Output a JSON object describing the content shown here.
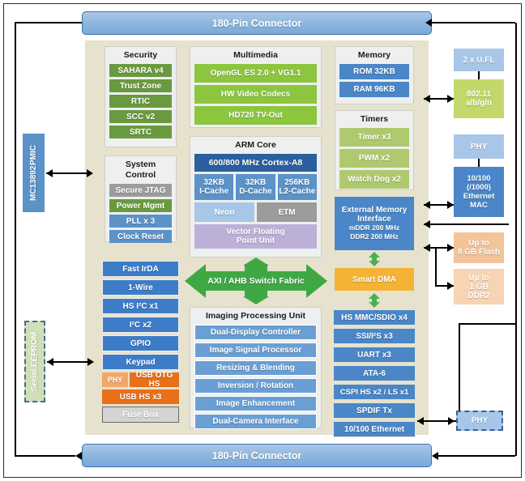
{
  "connectors": {
    "top": "180-Pin Connector",
    "bottom": "180-Pin Connector"
  },
  "security": {
    "title": "Security",
    "items": [
      "SAHARA v4",
      "Trust Zone",
      "RTIC",
      "SCC v2",
      "SRTC"
    ]
  },
  "system_control": {
    "title": "System Control",
    "items": [
      "Secure JTAG",
      "Power Mgmt",
      "PLL x 3",
      "Clock Reset"
    ]
  },
  "multimedia": {
    "title": "Multimedia",
    "items": [
      "OpenGL ES 2.0 + VG1.1",
      "HW Video Codecs",
      "HD720 TV-Out"
    ]
  },
  "arm_core": {
    "title": "ARM Core",
    "cpu": "600/800 MHz Cortex-A8",
    "caches": [
      {
        "size": "32KB",
        "name": "I-Cache"
      },
      {
        "size": "32KB",
        "name": "D-Cache"
      },
      {
        "size": "256KB",
        "name": "L2-Cache"
      }
    ],
    "neon": "Neon",
    "etm": "ETM",
    "vfp_line1": "Vector Floating",
    "vfp_line2": "Point Unit"
  },
  "memory": {
    "title": "Memory",
    "items": [
      "ROM 32KB",
      "RAM 96KB"
    ]
  },
  "timers": {
    "title": "Timers",
    "items": [
      "Timer x3",
      "PWM x2",
      "Watch Dog x2"
    ]
  },
  "emi": {
    "line1": "External Memory",
    "line2": "Interface",
    "line3": "mDDR 200 MHz",
    "line4": "DDR2 200 MHz"
  },
  "dma": {
    "label": "Smart DMA"
  },
  "fabric": {
    "label": "AXI / AHB Switch Fabric"
  },
  "ipu": {
    "title": "Imaging Processing Unit",
    "items": [
      "Dual-Display Controller",
      "Image Signal Processor",
      "Resizing & Blending",
      "Inversion / Rotation",
      "Image Enhancement",
      "Dual-Camera Interface"
    ]
  },
  "left_peripherals": {
    "items": [
      {
        "label": "Fast IrDA",
        "style": "blue"
      },
      {
        "label": "1-Wire",
        "style": "blue"
      },
      {
        "label": "HS I²C x1",
        "style": "blue"
      },
      {
        "label": "I²C x2",
        "style": "blue"
      },
      {
        "label": "GPIO",
        "style": "blue"
      },
      {
        "label": "Keypad",
        "style": "blue"
      }
    ],
    "usb_phy": "PHY",
    "usb_otg": "USB OTG HS",
    "usb_hs": "USB HS x3",
    "fuse_box": "Fuse Box"
  },
  "right_peripherals": {
    "items": [
      "HS MMC/SDIO x4",
      "SSI/I²S x3",
      "UART x3",
      "ATA-6",
      "CSPI HS x2 / LS x1",
      "SPDIF Tx",
      "10/100 Ethernet"
    ]
  },
  "externals": {
    "ufl": "2 x U.FL",
    "wifi_line1": "802.11",
    "wifi_line2": "a/b/g/n",
    "phy_top": "PHY",
    "emac_line1": "10/100",
    "emac_line2": "(/1000)",
    "emac_line3": "Ethernet",
    "emac_line4": "MAC",
    "flash_line1": "Up to",
    "flash_line2": "8 GB Flash",
    "ddr_line1": "Up to",
    "ddr_line2": "1 GB",
    "ddr_line3": "DDR2",
    "phy_bottom": "PHY",
    "pmic_line1": "MC13892",
    "pmic_line2": "PMIC",
    "eeprom": "Serial EEPROM"
  },
  "colors": {
    "panel_bg": "#e6e2cd",
    "connector": "#8cb4de",
    "security_green": "#6a9a3f",
    "multimedia_green": "#8cc63e",
    "timers_olive": "#afc96e",
    "core_blue": "#3d7cc9",
    "ipu_blue": "#6a9fd4",
    "usb_orange": "#e8701a",
    "dma_amber": "#f5b335",
    "vfp_lavender": "#bdb0d8",
    "external_peach": "#f2c49a"
  }
}
